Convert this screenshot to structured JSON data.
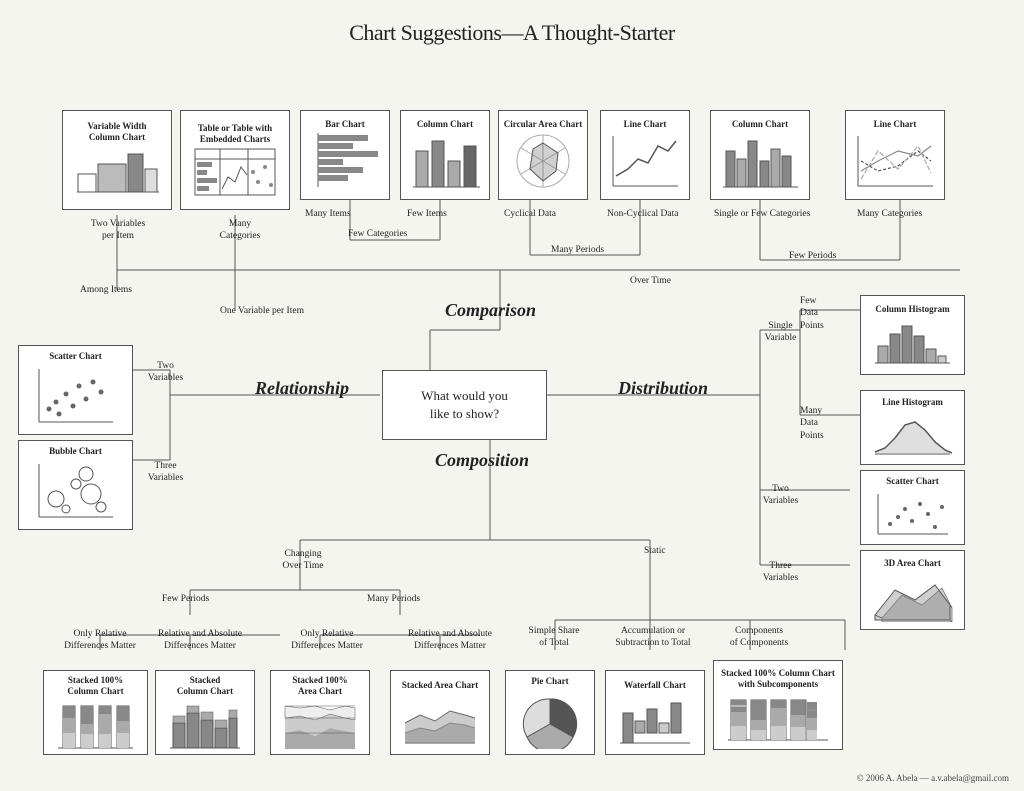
{
  "title": "Chart Suggestions—A Thought-Starter",
  "footer": "© 2006  A. Abela — a.v.abela@gmail.com",
  "center_box": {
    "text": "What would you\nlike to show?"
  },
  "sections": {
    "comparison": "Comparison",
    "relationship": "Relationship",
    "distribution": "Distribution",
    "composition": "Composition"
  },
  "chart_boxes": [
    {
      "id": "variable-width",
      "title": "Variable Width\nColumn Chart",
      "type": "variable-width"
    },
    {
      "id": "table-embedded",
      "title": "Table or Table with\nEmbedded Charts",
      "type": "table"
    },
    {
      "id": "bar-chart-1",
      "title": "Bar Chart",
      "type": "bar"
    },
    {
      "id": "column-chart-1",
      "title": "Column Chart",
      "type": "column"
    },
    {
      "id": "circular-area",
      "title": "Circular Area Chart",
      "type": "circular"
    },
    {
      "id": "line-chart-1",
      "title": "Line Chart",
      "type": "line1"
    },
    {
      "id": "column-chart-2",
      "title": "Column Chart",
      "type": "column2"
    },
    {
      "id": "line-chart-2",
      "title": "Line Chart",
      "type": "line2"
    },
    {
      "id": "column-histogram",
      "title": "Column Histogram",
      "type": "col-hist"
    },
    {
      "id": "line-histogram",
      "title": "Line Histogram",
      "type": "line-hist"
    },
    {
      "id": "scatter-dist",
      "title": "Scatter Chart",
      "type": "scatter-dist"
    },
    {
      "id": "3d-area",
      "title": "3D Area Chart",
      "type": "area3d"
    },
    {
      "id": "scatter-rel",
      "title": "Scatter Chart",
      "type": "scatter-rel"
    },
    {
      "id": "bubble",
      "title": "Bubble Chart",
      "type": "bubble"
    },
    {
      "id": "stacked100-col",
      "title": "Stacked 100%\nColumn Chart",
      "type": "stacked100col"
    },
    {
      "id": "stacked-col",
      "title": "Stacked\nColumn Chart",
      "type": "stackedcol"
    },
    {
      "id": "stacked100-area",
      "title": "Stacked 100%\nArea Chart",
      "type": "stacked100area"
    },
    {
      "id": "stacked-area",
      "title": "Stacked Area Chart",
      "type": "stackedarea"
    },
    {
      "id": "pie",
      "title": "Pie Chart",
      "type": "pie"
    },
    {
      "id": "waterfall",
      "title": "Waterfall Chart",
      "type": "waterfall"
    },
    {
      "id": "stacked100-sub",
      "title": "Stacked 100% Column Chart\nwith Subcomponents",
      "type": "stacked100sub"
    }
  ],
  "labels": [
    "Two Variables\nper Item",
    "Many\nCategories",
    "Many Items",
    "Few Items",
    "Cyclical Data",
    "Non-Cyclical Data",
    "Single or Few Categories",
    "Many Categories",
    "Few Categories",
    "Many Periods",
    "Few Periods",
    "One Variable per Item",
    "Among Items",
    "Over Time",
    "Two\nVariables",
    "Three\nVariables",
    "Single\nVariable",
    "Few\nData\nPoints",
    "Many\nData\nPoints",
    "Two\nVariables",
    "Three\nVariables",
    "Changing\nOver Time",
    "Static",
    "Few Periods",
    "Many Periods",
    "Only Relative\nDifferences Matter",
    "Relative and Absolute\nDifferences Matter",
    "Only Relative\nDifferences Matter",
    "Relative and Absolute\nDifferences Matter",
    "Simple Share\nof Total",
    "Accumulation or\nSubtraction to Total",
    "Components\nof Components"
  ]
}
